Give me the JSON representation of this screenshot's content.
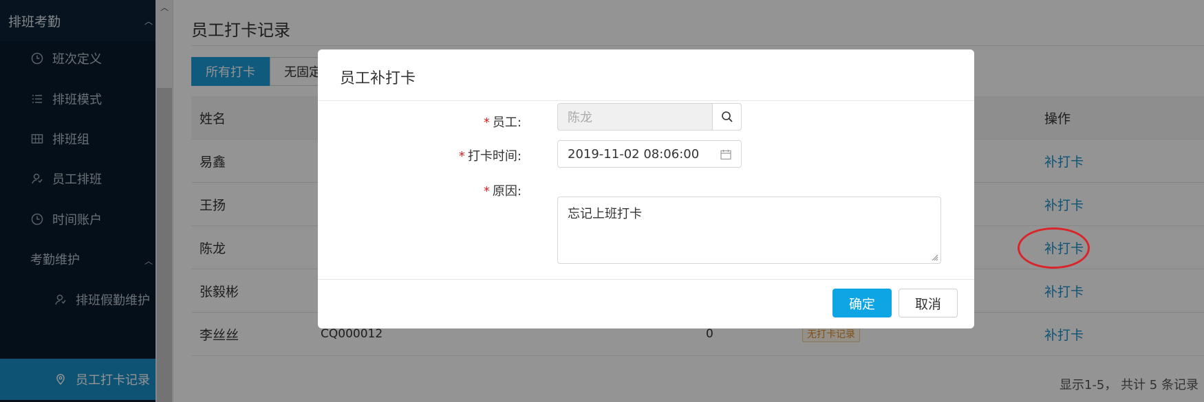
{
  "sidebar": {
    "group1": "排班考勤",
    "items": [
      {
        "label": "班次定义",
        "icon": "clock-icon"
      },
      {
        "label": "排班模式",
        "icon": "list-icon"
      },
      {
        "label": "排班组",
        "icon": "table-icon"
      },
      {
        "label": "员工排班",
        "icon": "user-icon"
      },
      {
        "label": "时间账户",
        "icon": "clock-icon"
      }
    ],
    "group2": "考勤维护",
    "sub_items": [
      {
        "label": "排班假勤维护",
        "icon": "user-icon"
      },
      {
        "label": "员工打卡记录",
        "icon": "location-icon"
      }
    ]
  },
  "main": {
    "title": "员工打卡记录",
    "tabs": [
      "所有打卡",
      "无固定"
    ],
    "table": {
      "headers": {
        "name": "姓名",
        "op": "操作"
      },
      "rows": [
        {
          "name": "易鑫",
          "code": "",
          "count": "",
          "status": "",
          "op": "补打卡"
        },
        {
          "name": "王扬",
          "code": "",
          "count": "",
          "status": "",
          "op": "补打卡"
        },
        {
          "name": "陈龙",
          "code": "",
          "count": "",
          "status": "",
          "op": "补打卡"
        },
        {
          "name": "张毅彬",
          "code": "",
          "count": "",
          "status": "",
          "op": "补打卡"
        },
        {
          "name": "李丝丝",
          "code": "CQ000012",
          "count": "0",
          "status": "无打卡记录",
          "op": "补打卡"
        }
      ]
    },
    "footer": "显示1-5， 共计 5 条记录"
  },
  "modal": {
    "title": "员工补打卡",
    "employee_label": "员工:",
    "employee_value": "陈龙",
    "time_label": "打卡时间:",
    "time_value": "2019-11-02 08:06:00",
    "reason_label": "原因:",
    "reason_value": "忘记上班打卡",
    "ok_label": "确定",
    "cancel_label": "取消",
    "required_mark": "*"
  },
  "colors": {
    "accent": "#1a9bd7",
    "sidebar_bg": "#071a2c",
    "annotation": "#d9252a"
  }
}
